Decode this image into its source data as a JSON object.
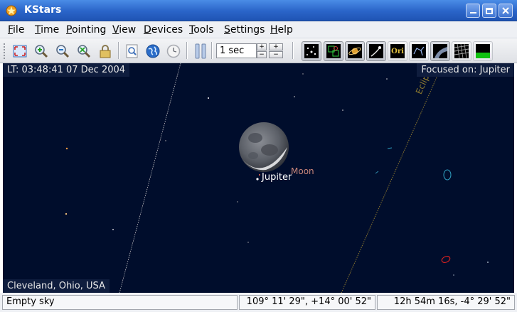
{
  "window": {
    "title": "KStars"
  },
  "menu": {
    "items": [
      {
        "key": "F",
        "rest": "ile"
      },
      {
        "key": "T",
        "rest": "ime"
      },
      {
        "key": "P",
        "rest": "ointing"
      },
      {
        "key": "V",
        "rest": "iew"
      },
      {
        "key": "D",
        "rest": "evices"
      },
      {
        "key": "T",
        "rest": "ools"
      },
      {
        "key": "S",
        "rest": "ettings"
      },
      {
        "key": "H",
        "rest": "elp"
      }
    ]
  },
  "toolbar": {
    "time_step": "1 sec",
    "ori_label": "Ori"
  },
  "sky": {
    "local_time": "LT: 03:48:41   07 Dec 2004",
    "focus": "Focused on: Jupiter",
    "location": "Cleveland, Ohio,  USA",
    "labels": {
      "ecliptic": "Ecliptic",
      "moon": "Moon",
      "jupiter": "Jupiter"
    },
    "colors": {
      "background": "#000d2c",
      "ecliptic": "#8c7a2e",
      "moon_label": "#c9877a",
      "equator": "#c8c8c8"
    }
  },
  "status": {
    "object": "Empty sky",
    "altaz": "109° 11' 29\",  +14° 00' 52\"",
    "radec": "12h 54m 16s,  -4° 29' 52\""
  }
}
